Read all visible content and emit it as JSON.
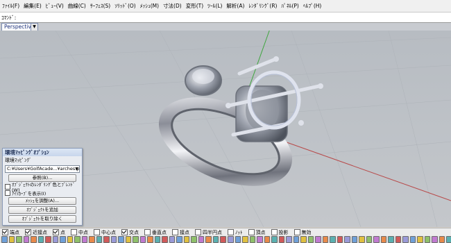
{
  "menu": [
    "ﾌｧｲﾙ(F)",
    "編集(E)",
    "ﾋﾞｭｰ(V)",
    "曲線(C)",
    "ｻｰﾌｪｽ(S)",
    "ｿﾘｯﾄﾞ(O)",
    "ﾒｯｼｭ(M)",
    "寸法(D)",
    "変形(T)",
    "ﾂｰﾙ(L)",
    "解析(A)",
    "ﾚﾝﾀﾞﾘﾝｸﾞ(R)",
    "ﾊﾟﾈﾙ(P)",
    "ﾍﾙﾌﾟ(H)"
  ],
  "command": {
    "label": "ｺﾏﾝﾄﾞ:"
  },
  "viewport": {
    "tab": "Perspective",
    "tab_arrow": "▼"
  },
  "panel": {
    "title": "環境ﾏｯﾋﾟﾝｸﾞｵﾌﾟｼｮﾝ",
    "section": "環境ﾏｯﾋﾟﾝｸﾞ",
    "file_value": "C:¥Users¥GolfAcade...¥arches.png",
    "browse": "参照(B)...",
    "check_blend": "ｵﾌﾞｼﾞｪｸﾄのﾚﾝﾀﾞﾘﾝｸﾞ色とﾌﾞﾚﾝﾄﾞ(W)",
    "check_icon": "ｱｲｿｶｰﾌﾞを表示(I)",
    "btn_adjust": "ﾒｯｼｭを調整(A)...",
    "btn_add": "ｵﾌﾞｼﾞｪｸﾄを追加",
    "btn_remove": "ｵﾌﾞｼﾞｪｸﾄを取り除く"
  },
  "osnaps": [
    {
      "label": "端点",
      "checked": true
    },
    {
      "label": "近接点",
      "checked": true
    },
    {
      "label": "点",
      "checked": true
    },
    {
      "label": "中点",
      "checked": false
    },
    {
      "label": "中心点",
      "checked": false
    },
    {
      "label": "交点",
      "checked": true
    },
    {
      "label": "垂直点",
      "checked": false
    },
    {
      "label": "接点",
      "checked": false
    },
    {
      "label": "四半円点",
      "checked": false
    },
    {
      "label": "ﾉｯﾄ",
      "checked": false
    },
    {
      "label": "頂点",
      "checked": false
    },
    {
      "label": "投影",
      "checked": false
    },
    {
      "label": "無効",
      "checked": false
    }
  ],
  "colors": {
    "x_axis": "#b84a4a",
    "y_axis": "#3fa63f",
    "accent": "#1a2f7a"
  }
}
